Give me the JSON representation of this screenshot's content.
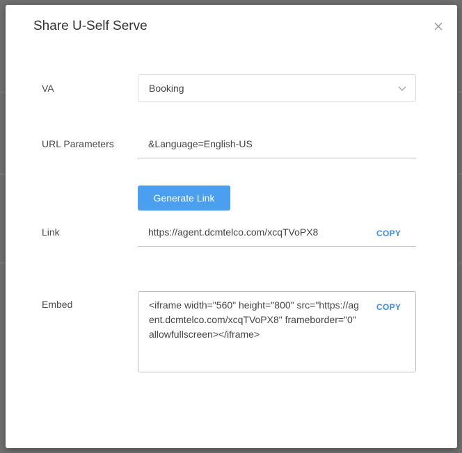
{
  "dialog": {
    "title": "Share U-Self Serve",
    "close_icon": "close-icon"
  },
  "fields": {
    "va": {
      "label": "VA",
      "value": "Booking",
      "icon": "chevron-down-icon"
    },
    "url_parameters": {
      "label": "URL Parameters",
      "value": "&Language=English-US"
    },
    "generate_button": "Generate Link",
    "link": {
      "label": "Link",
      "value": "https://agent.dcmtelco.com/xcqTVoPX8",
      "copy_label": "COPY"
    },
    "embed": {
      "label": "Embed",
      "value": "<iframe width=\"560\" height=\"800\" src=\"https://agent.dcmtelco.com/xcqTVoPX8\" frameborder=\"0\" allowfullscreen></iframe>",
      "copy_label": "COPY"
    }
  },
  "colors": {
    "accent": "#4a9ff0",
    "copy_link": "#3b8de0"
  }
}
